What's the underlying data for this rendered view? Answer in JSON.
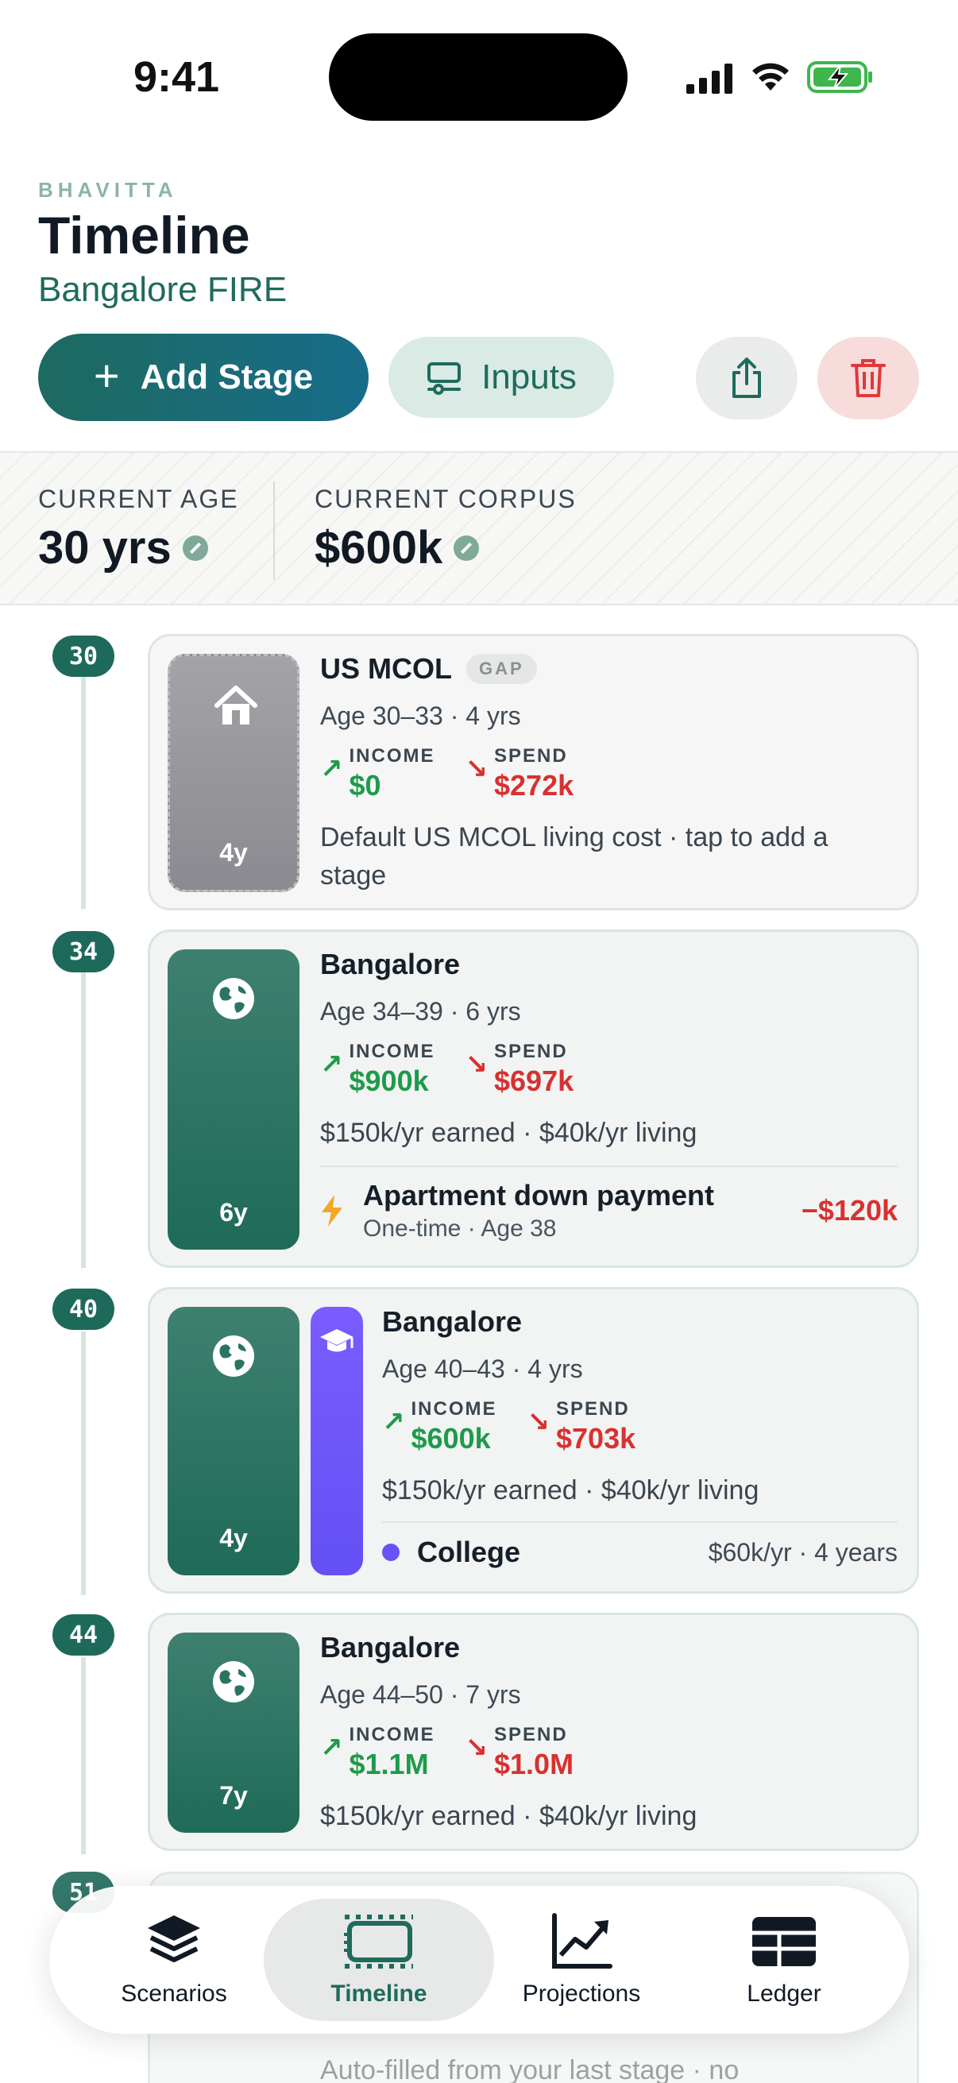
{
  "status": {
    "time": "9:41"
  },
  "header": {
    "brand": "BHAVITTA",
    "title": "Timeline",
    "subtitle": "Bangalore FIRE",
    "add_label": "Add Stage",
    "inputs_label": "Inputs",
    "share_icon": "share-icon",
    "delete_icon": "trash-icon"
  },
  "summary": {
    "age_label": "CURRENT AGE",
    "age_value": "30 yrs",
    "corpus_label": "CURRENT CORPUS",
    "corpus_value": "$600k"
  },
  "flow_labels": {
    "income": "INCOME",
    "spend": "SPEND",
    "up": "↗",
    "down": "↘"
  },
  "stages": [
    {
      "age": "30",
      "name": "US MCOL",
      "tag": "GAP",
      "range": "Age 30–33 · 4 yrs",
      "income": "$0",
      "spend": "$272k",
      "duration": "4y",
      "desc": "Default US MCOL living cost · tap to add a stage",
      "icon": "house-icon"
    },
    {
      "age": "34",
      "name": "Bangalore",
      "range": "Age 34–39 · 6 yrs",
      "income": "$900k",
      "spend": "$697k",
      "duration": "6y",
      "desc": "$150k/yr earned · $40k/yr living",
      "icon": "globe-icon",
      "event": {
        "name": "Apartment down payment",
        "sub": "One-time · Age 38",
        "amount": "−$120k",
        "icon": "bolt-icon"
      }
    },
    {
      "age": "40",
      "name": "Bangalore",
      "range": "Age 40–43 · 4 yrs",
      "income": "$600k",
      "spend": "$703k",
      "duration": "4y",
      "desc": "$150k/yr earned · $40k/yr living",
      "icon": "globe-icon",
      "event": {
        "name": "College",
        "meta": "$60k/yr · 4 years",
        "icon": "graduation-cap-icon"
      }
    },
    {
      "age": "44",
      "name": "Bangalore",
      "range": "Age 44–50 · 7 yrs",
      "income": "$1.1M",
      "spend": "$1.0M",
      "duration": "7y",
      "desc": "$150k/yr earned · $40k/yr living",
      "icon": "globe-icon"
    },
    {
      "age": "51",
      "desc": "Auto-filled from your last stage · no"
    }
  ],
  "tabs": [
    {
      "label": "Scenarios",
      "icon": "layers-icon"
    },
    {
      "label": "Timeline",
      "icon": "timeline-icon",
      "active": true
    },
    {
      "label": "Projections",
      "icon": "chart-icon"
    },
    {
      "label": "Ledger",
      "icon": "table-icon"
    }
  ],
  "colors": {
    "accent": "#1d6a5b",
    "income": "#1f9a4a",
    "spend": "#d93030",
    "college": "#6a52f5"
  }
}
